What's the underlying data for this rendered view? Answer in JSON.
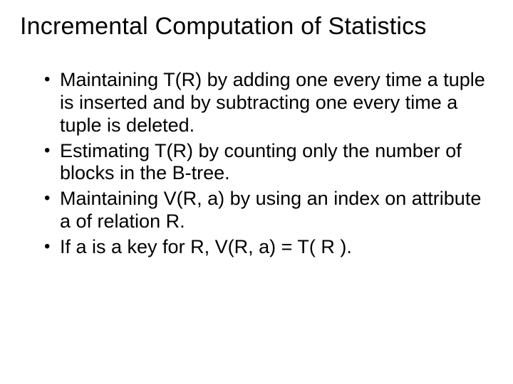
{
  "slide": {
    "title": "Incremental Computation of Statistics",
    "bullets": [
      "Maintaining T(R) by adding one every time a tuple is inserted and by subtracting one every time a tuple is deleted.",
      "Estimating T(R) by counting only the number of blocks in the B-tree.",
      "Maintaining V(R, a) by using an index on attribute a of relation R.",
      "If a is a key for R, V(R, a) = T( R )."
    ]
  }
}
